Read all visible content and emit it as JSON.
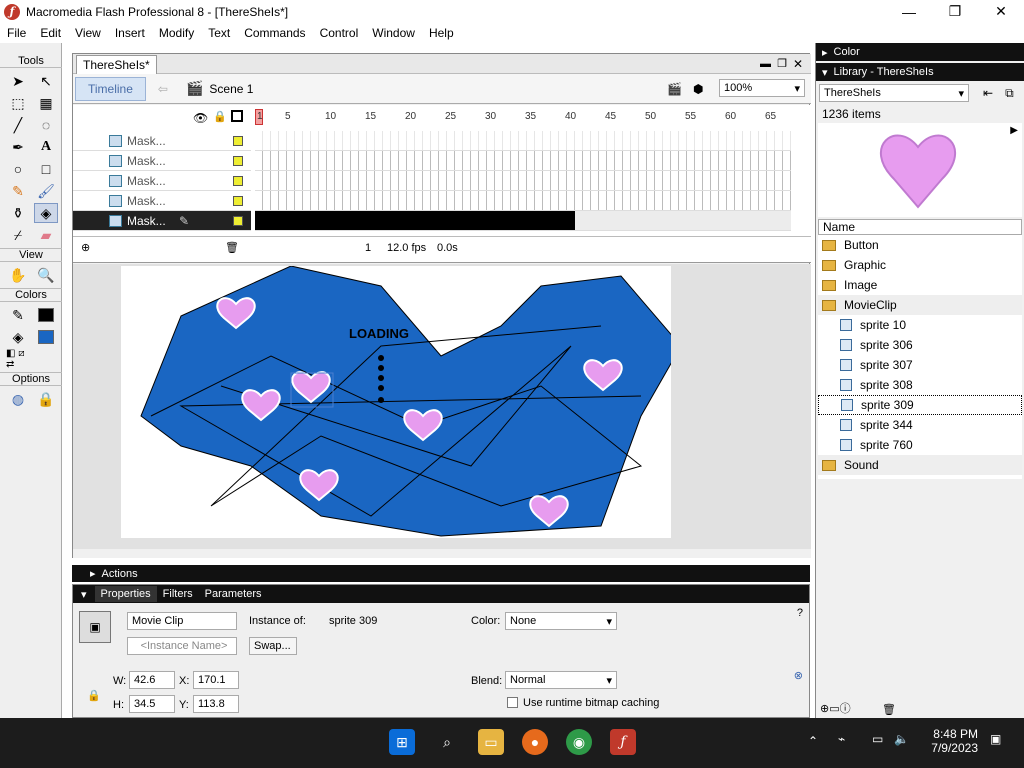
{
  "window": {
    "title": "Macromedia Flash Professional 8 - [ThereSheIs*]",
    "minimize": "—",
    "maximize": "❐",
    "close": "✕"
  },
  "menu": [
    "File",
    "Edit",
    "View",
    "Insert",
    "Modify",
    "Text",
    "Commands",
    "Control",
    "Window",
    "Help"
  ],
  "tools": {
    "title": "Tools",
    "view_title": "View",
    "colors_title": "Colors",
    "options_title": "Options"
  },
  "document": {
    "tab": "ThereSheIs*",
    "timeline_button": "Timeline",
    "scene": "Scene 1",
    "zoom": "100%",
    "layers": [
      "Mask...",
      "Mask...",
      "Mask...",
      "Mask...",
      "Mask..."
    ],
    "ruler_ticks": [
      "1",
      "5",
      "10",
      "15",
      "20",
      "25",
      "30",
      "35",
      "40",
      "45",
      "50",
      "55",
      "60",
      "65"
    ],
    "status": {
      "frame": "1",
      "fps": "12.0 fps",
      "time": "0.0s"
    },
    "stage_text": "LOADING"
  },
  "panels": {
    "color_title": "Color",
    "library_title": "Library - ThereSheIs",
    "library_select": "ThereSheIs",
    "item_count": "1236 items",
    "name_header": "Name",
    "items": [
      {
        "label": "Button",
        "type": "folder"
      },
      {
        "label": "Graphic",
        "type": "folder"
      },
      {
        "label": "Image",
        "type": "folder"
      },
      {
        "label": "MovieClip",
        "type": "folder"
      },
      {
        "label": "sprite 10",
        "type": "sprite"
      },
      {
        "label": "sprite 306",
        "type": "sprite"
      },
      {
        "label": "sprite 307",
        "type": "sprite"
      },
      {
        "label": "sprite 308",
        "type": "sprite"
      },
      {
        "label": "sprite 309",
        "type": "sprite"
      },
      {
        "label": "sprite 344",
        "type": "sprite"
      },
      {
        "label": "sprite 760",
        "type": "sprite"
      },
      {
        "label": "Sound",
        "type": "folder"
      }
    ],
    "selected_item": "sprite 309"
  },
  "actions": {
    "label": "Actions"
  },
  "properties": {
    "tabs": [
      "Properties",
      "Filters",
      "Parameters"
    ],
    "symbol_type": "Movie Clip",
    "instance_placeholder": "<Instance Name>",
    "instance_of_label": "Instance of:",
    "instance_of": "sprite 309",
    "swap": "Swap...",
    "color_label": "Color:",
    "color_value": "None",
    "blend_label": "Blend:",
    "blend_value": "Normal",
    "cache_label": "Use runtime bitmap caching",
    "w_label": "W:",
    "w": "42.6",
    "h_label": "H:",
    "h": "34.5",
    "x_label": "X:",
    "x": "170.1",
    "y_label": "Y:",
    "y": "113.8"
  },
  "taskbar": {
    "time": "8:48 PM",
    "date": "7/9/2023"
  },
  "colors": {
    "stage_blue": "#1a66c2",
    "heart": "#e79cef",
    "taskbar": "#1c1c1c"
  }
}
